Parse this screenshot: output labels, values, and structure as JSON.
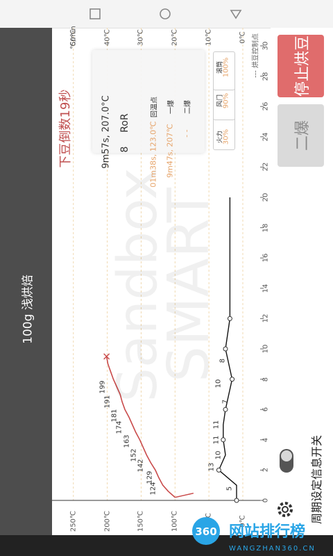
{
  "app": {
    "title": "100g 浅烘焙"
  },
  "countdown": "下豆倒数19秒",
  "chart": {
    "temp_ticks": [
      "0℃",
      "50℃",
      "100℃",
      "150℃",
      "200℃",
      "250℃"
    ],
    "temp_ticks_right": [
      "0℃",
      "10℃",
      "20℃",
      "30℃",
      "40℃",
      "50℃"
    ],
    "ror_unit": "℃/min",
    "time_ticks": [
      "0",
      "2",
      "4",
      "6",
      "8",
      "10",
      "12",
      "14",
      "16",
      "18",
      "20",
      "22",
      "24",
      "26",
      "28",
      "30"
    ],
    "temp_point_labels": [
      "124",
      "129",
      "142",
      "152",
      "163",
      "174",
      "181",
      "191",
      "199"
    ],
    "curve_labels": [
      "5",
      "13",
      "10",
      "11",
      "11",
      "7",
      "10",
      "8"
    ],
    "legend": "--- 烘豆控制点",
    "watermark_text": [
      "Sandbox",
      "SMART"
    ]
  },
  "chart_data": {
    "type": "line",
    "series": [
      {
        "x": [
          0.2,
          0.6,
          1.0,
          1.5,
          2.0,
          2.5,
          3.0,
          3.5,
          4.0,
          4.5,
          5.0,
          5.5,
          6.0,
          6.5,
          7.0,
          7.5,
          8.0,
          8.5,
          9.0,
          9.5
        ],
        "values": [
          100,
          110,
          118,
          124,
          129,
          136,
          142,
          147,
          152,
          158,
          163,
          168,
          174,
          178,
          181,
          186,
          191,
          195,
          199,
          201
        ]
      }
    ],
    "point_labels": {
      "x": [
        0.8,
        1.5,
        2.3,
        3.0,
        3.9,
        4.8,
        5.6,
        6.5,
        7.5
      ],
      "values": [
        124,
        129,
        142,
        152,
        163,
        174,
        181,
        191,
        199
      ]
    },
    "control_points": {
      "x": [
        0,
        1,
        2,
        3,
        4,
        5,
        6,
        8,
        10,
        12,
        14,
        16,
        18,
        20
      ],
      "values": [
        5,
        5,
        13,
        10,
        11,
        11,
        10,
        7,
        10,
        8,
        8,
        8,
        8,
        8
      ]
    },
    "xlabel": "",
    "ylabel": "",
    "xlim": [
      0,
      30
    ],
    "ylim": [
      0,
      250
    ]
  },
  "info": {
    "time_temp": "9m57s, 207.0°C",
    "ror_value": "8",
    "ror_label": "RoR",
    "turning_point": "01m38s, 123.0℃",
    "turning_label": "回温点",
    "first_crack": "9m47s, 207℃",
    "first_crack_label": "一爆",
    "second_crack": "- -",
    "second_crack_label": "二爆",
    "controls": [
      {
        "value": "30%",
        "label": "火力"
      },
      {
        "value": "90%",
        "label": "风门"
      },
      {
        "value": "100%",
        "label": "滚筒"
      }
    ]
  },
  "actions": {
    "stop_label": "停止烘豆",
    "second_crack_label": "二爆",
    "toggle_label": "周期设定信息开关",
    "colors": {
      "stop_bg": "#e06c6c",
      "second_bg": "#dadada"
    }
  },
  "watermark": {
    "brand": "网站排行榜",
    "url": "WANGZHAN360.CN",
    "num": "360"
  }
}
